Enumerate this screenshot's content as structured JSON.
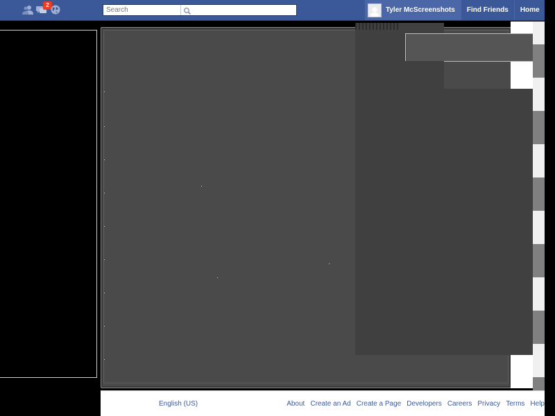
{
  "topbar": {
    "notifications_badge": "2",
    "search": {
      "placeholder": "Search",
      "value": ""
    },
    "profile_name": "Tyler McScreenshots",
    "find_friends": "Find Friends",
    "home": "Home",
    "colors": {
      "bar": "#3b5998",
      "badge": "#f03d25"
    }
  },
  "footer": {
    "language": "English (US)",
    "links": [
      "About",
      "Create an Ad",
      "Create a Page",
      "Developers",
      "Careers",
      "Privacy",
      "Terms",
      "Help"
    ]
  },
  "icons": [
    "friend-requests-icon",
    "messages-icon",
    "notifications-globe-icon",
    "search-icon",
    "avatar",
    "dropdown-arrow-icon"
  ]
}
